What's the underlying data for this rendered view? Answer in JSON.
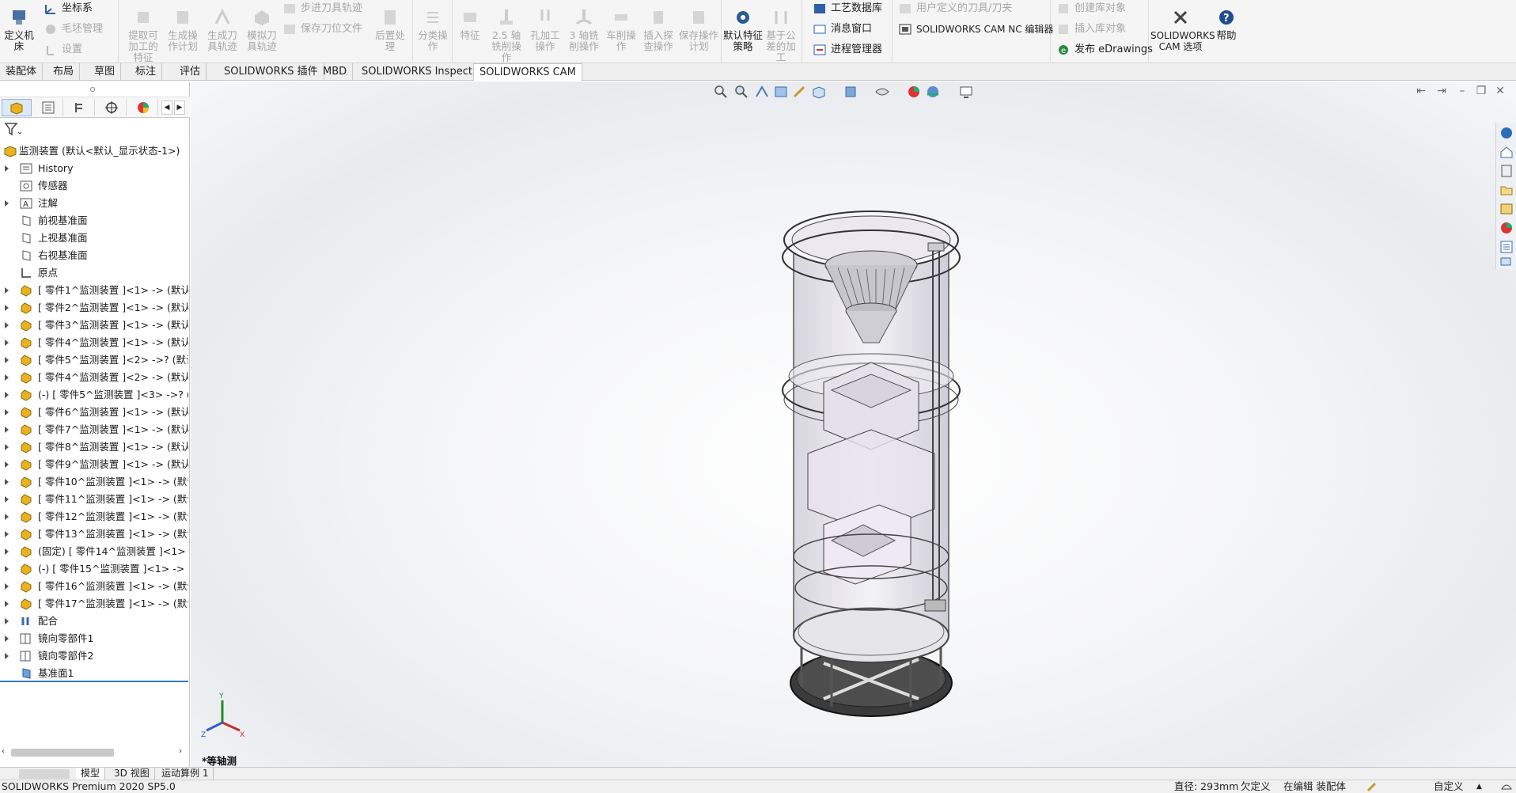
{
  "ribbon": {
    "machine_define_label": "定义机床",
    "coord_system_label": "坐标系",
    "stock_manager_label": "毛坯管理",
    "settings_label": "设置",
    "extract_features_label": "提取可加工的特征",
    "gen_op_plan_label": "生成操作计划",
    "gen_toolpath_label": "生成刀具轨迹",
    "simulate_toolpath_label": "模拟刀具轨迹",
    "step_toolpath_label": "步进刀具轨迹",
    "save_cl_file_label": "保存刀位文件",
    "post_process_label": "后置处理",
    "classify_op_label": "分类操作",
    "feature_label": "特征",
    "mill_25_label": "2.5 轴铣削操作",
    "hole_op_label": "孔加工操作",
    "mill_3_label": "3 轴铣削操作",
    "turn_op_label": "车削操作",
    "insert_probe_label": "插入探查操作",
    "save_op_plan_label": "保存操作计划",
    "tolerance_machining_label": "基于公差的加工",
    "default_strategy_label": "默认特征策略",
    "tech_db_label": "工艺数据库",
    "message_window_label": "消息窗口",
    "process_manager_label": "进程管理器",
    "user_tools_label": "用户定义的刀具/刀夹",
    "nc_editor_label": "SOLIDWORKS CAM NC 编辑器",
    "publish_edrawings_label": "发布 eDrawings",
    "create_lib_obj_label": "创建库对象",
    "insert_lib_obj_label": "插入库对象",
    "cam_options_label": "SOLIDWORKS CAM 选项",
    "help_label": "帮助"
  },
  "tabs": [
    "装配体",
    "布局",
    "草图",
    "标注",
    "评估",
    "SOLIDWORKS 插件",
    "MBD",
    "SOLIDWORKS Inspection",
    "SOLIDWORKS CAM"
  ],
  "tree": {
    "root": "监测装置 (默认<默认_显示状态-1>)",
    "items": [
      {
        "label": "History",
        "expand": true,
        "icon": "history-icon"
      },
      {
        "label": "传感器",
        "expand": false,
        "icon": "sensor-icon"
      },
      {
        "label": "注解",
        "expand": true,
        "icon": "annotation-icon"
      },
      {
        "label": "前视基准面",
        "expand": false,
        "icon": "plane-icon"
      },
      {
        "label": "上视基准面",
        "expand": false,
        "icon": "plane-icon"
      },
      {
        "label": "右视基准面",
        "expand": false,
        "icon": "plane-icon"
      },
      {
        "label": "原点",
        "expand": false,
        "icon": "origin-icon"
      },
      {
        "label": "[ 零件1^监测装置 ]<1> -> (默认<",
        "expand": true,
        "icon": "part-icon"
      },
      {
        "label": "[ 零件2^监测装置 ]<1> -> (默认<",
        "expand": true,
        "icon": "part-icon"
      },
      {
        "label": "[ 零件3^监测装置 ]<1> -> (默认<",
        "expand": true,
        "icon": "part-icon"
      },
      {
        "label": "[ 零件4^监测装置 ]<1> -> (默认<",
        "expand": true,
        "icon": "part-icon"
      },
      {
        "label": "[ 零件5^监测装置 ]<2> ->? (默认<",
        "expand": true,
        "icon": "part-icon"
      },
      {
        "label": "[ 零件4^监测装置 ]<2> -> (默认<",
        "expand": true,
        "icon": "part-icon"
      },
      {
        "label": "(-) [ 零件5^监测装置 ]<3> ->? (默",
        "expand": true,
        "icon": "part-icon"
      },
      {
        "label": "[ 零件6^监测装置 ]<1> -> (默认<",
        "expand": true,
        "icon": "part-icon"
      },
      {
        "label": "[ 零件7^监测装置 ]<1> -> (默认<",
        "expand": true,
        "icon": "part-icon"
      },
      {
        "label": "[ 零件8^监测装置 ]<1> -> (默认<",
        "expand": true,
        "icon": "part-icon"
      },
      {
        "label": "[ 零件9^监测装置 ]<1> -> (默认<",
        "expand": true,
        "icon": "part-icon"
      },
      {
        "label": "[ 零件10^监测装置 ]<1> -> (默认<",
        "expand": true,
        "icon": "part-icon"
      },
      {
        "label": "[ 零件11^监测装置 ]<1> -> (默认<",
        "expand": true,
        "icon": "part-icon"
      },
      {
        "label": "[ 零件12^监测装置 ]<1> -> (默认<",
        "expand": true,
        "icon": "part-icon"
      },
      {
        "label": "[ 零件13^监测装置 ]<1> -> (默认<",
        "expand": true,
        "icon": "part-icon"
      },
      {
        "label": "(固定) [ 零件14^监测装置 ]<1> -> (默",
        "expand": true,
        "icon": "part-icon"
      },
      {
        "label": "(-) [ 零件15^监测装置 ]<1> -> (默",
        "expand": true,
        "icon": "part-icon"
      },
      {
        "label": "[ 零件16^监测装置 ]<1> -> (默认<",
        "expand": true,
        "icon": "part-icon"
      },
      {
        "label": "[ 零件17^监测装置 ]<1> -> (默认<",
        "expand": true,
        "icon": "part-icon"
      },
      {
        "label": "配合",
        "expand": true,
        "icon": "mates-icon"
      },
      {
        "label": "镜向零部件1",
        "expand": true,
        "icon": "mirror-icon"
      },
      {
        "label": "镜向零部件2",
        "expand": true,
        "icon": "mirror-icon"
      },
      {
        "label": "基准面1",
        "expand": false,
        "icon": "plane-blue-icon"
      }
    ]
  },
  "viewport": {
    "view_label": "*等轴测"
  },
  "bottom_tabs": [
    "模型",
    "3D 视图",
    "运动算例 1"
  ],
  "status": {
    "product": "SOLIDWORKS Premium 2020 SP5.0",
    "measurement": "直径: 293mm",
    "state": "欠定义",
    "editing": "在编辑 装配体",
    "custom": "自定义"
  },
  "colors": {
    "accent": "#3a78c2",
    "part_icon": "#e9b320"
  }
}
